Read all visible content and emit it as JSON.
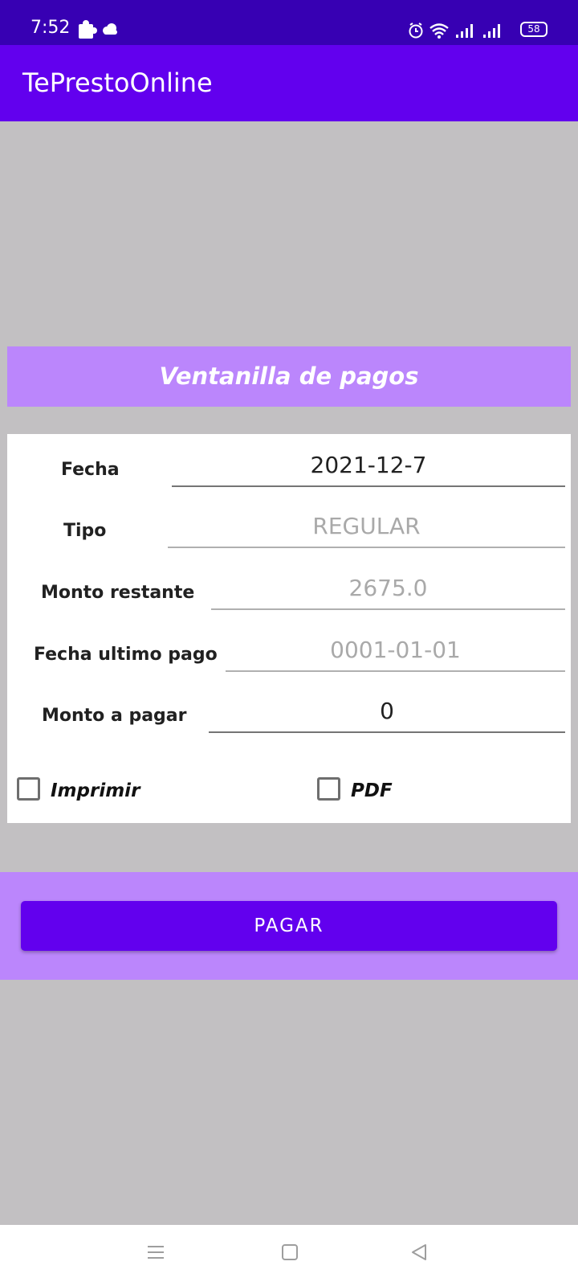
{
  "status_bar": {
    "time": "7:52",
    "battery": "58",
    "icons": [
      "puzzle-icon",
      "cloud-icon",
      "alarm-icon",
      "wifi-icon",
      "signal-icon",
      "signal-icon",
      "battery-icon"
    ]
  },
  "app_bar": {
    "title": "TePrestoOnline"
  },
  "section": {
    "title": "Ventanilla de pagos"
  },
  "form": {
    "fecha": {
      "label": "Fecha",
      "value": "2021-12-7"
    },
    "tipo": {
      "label": "Tipo",
      "value": "REGULAR"
    },
    "monto_restante": {
      "label": "Monto restante",
      "value": "2675.0"
    },
    "fecha_ultimo_pago": {
      "label": "Fecha ultimo pago",
      "value": "0001-01-01"
    },
    "monto_a_pagar": {
      "label": "Monto a pagar",
      "value": "0"
    },
    "imprimir": {
      "label": "Imprimir",
      "checked": false
    },
    "pdf": {
      "label": "PDF",
      "checked": false
    }
  },
  "pay_button": {
    "label": "PAGAR"
  },
  "nav_bar": {
    "icons": [
      "menu-icon",
      "home-icon",
      "back-icon"
    ]
  },
  "colors": {
    "status_bar": "#3700b3",
    "primary": "#6200ee",
    "secondary": "#bb86fc",
    "background": "#c2c0c2"
  }
}
